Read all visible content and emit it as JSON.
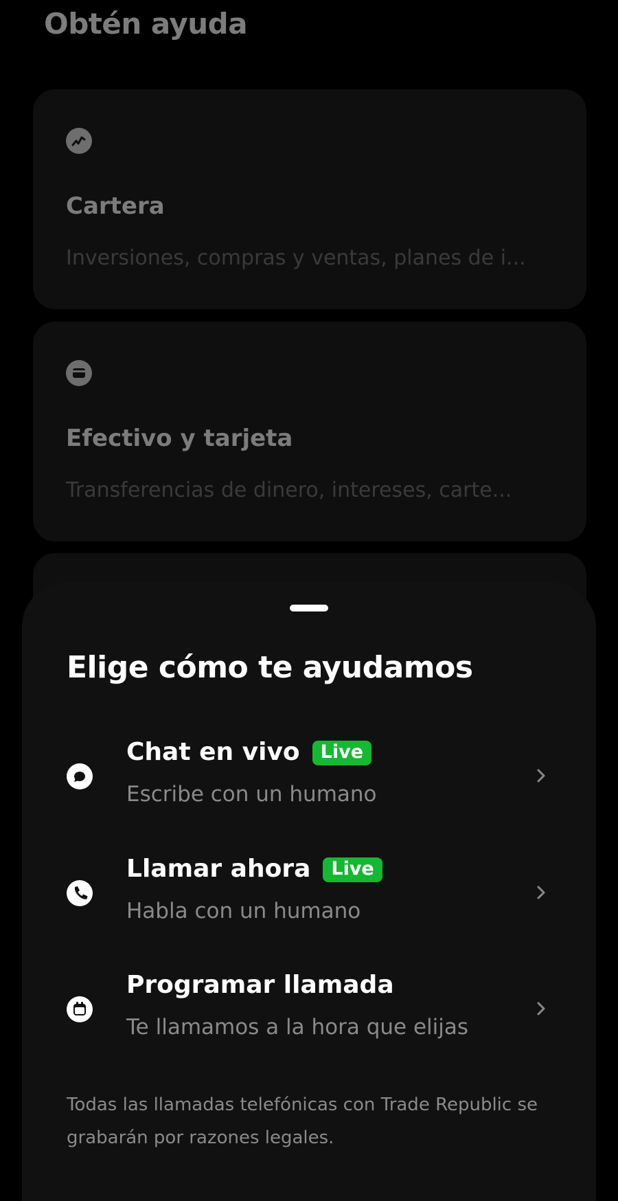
{
  "background": {
    "title": "Obtén ayuda",
    "cards": [
      {
        "title": "Cartera",
        "description": "Inversiones, compras y ventas, planes de i...",
        "icon": "chart-trend-icon"
      },
      {
        "title": "Efectivo y tarjeta",
        "description": "Transferencias de dinero, intereses, carte...",
        "icon": "card-icon"
      },
      {
        "title": "",
        "description": ""
      }
    ]
  },
  "sheet": {
    "title": "Elige cómo te ayudamos",
    "options": [
      {
        "title": "Chat en vivo",
        "badge": "Live",
        "subtitle": "Escribe con un humano",
        "icon": "chat-bubble-icon"
      },
      {
        "title": "Llamar ahora",
        "badge": "Live",
        "subtitle": "Habla con un humano",
        "icon": "phone-icon"
      },
      {
        "title": "Programar llamada",
        "subtitle": "Te llamamos a la hora que elijas",
        "icon": "calendar-icon"
      }
    ],
    "disclaimer": "Todas las llamadas telefónicas con Trade Republic se grabarán por razones legales."
  },
  "colors": {
    "background": "#000000",
    "sheet": "#111111",
    "live_badge": "#14b832",
    "muted_text": "#8a8a8a"
  }
}
